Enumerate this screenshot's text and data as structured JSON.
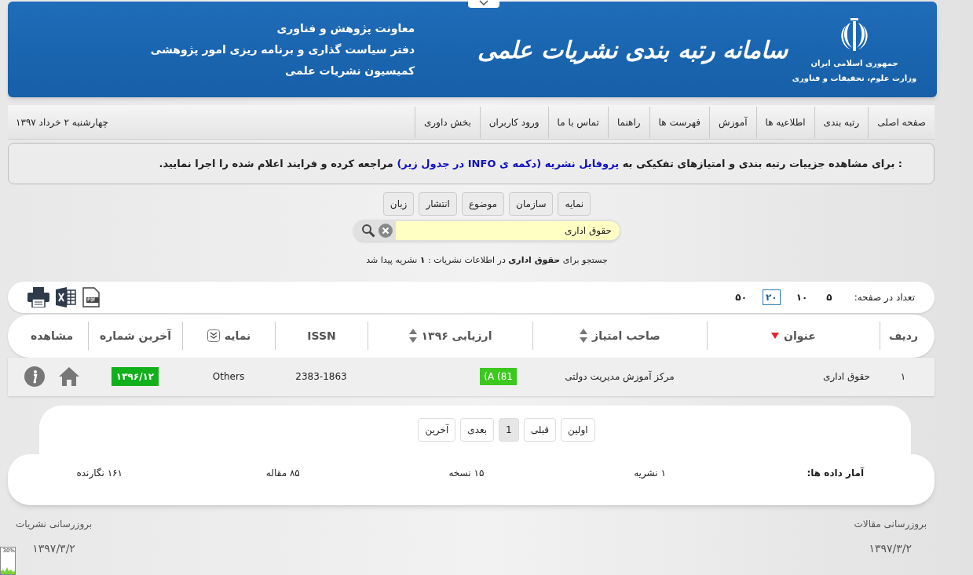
{
  "header": {
    "emblem_lines": [
      "جمهوری اسلامی ایران",
      "وزارت علوم، تحقیقات و فناوری"
    ],
    "site_title": "سامانه رتبه بندی نشریات علمی",
    "org_lines": [
      "معاونت پژوهش و فناوری",
      "دفتر سیاست گذاری و برنامه ریزی امور پژوهشی",
      "کمیسیون نشریات علمی"
    ]
  },
  "nav": {
    "items": [
      "صفحه اصلی",
      "رتبه بندی",
      "اطلاعیه ها",
      "آموزش",
      "فهرست ها",
      "راهنما",
      "تماس با ما",
      "ورود کاربران",
      "بخش داوری"
    ],
    "date": "چهارشنبه ۲ خرداد ۱۳۹۷"
  },
  "notice": {
    "before": ": برای مشاهده جزییات رتبه بندی و امتیازهای تفکیکی به ",
    "link": "پروفایل نشریه (دکمه ی INFO در جدول زیر)",
    "after": " مراجعه کرده و فرایند اعلام شده را اجرا نمایید."
  },
  "filters": [
    "نمایه",
    "سازمان",
    "موضوع",
    "انتشار",
    "زبان"
  ],
  "search": {
    "value": "حقوق اداری"
  },
  "result_text": "جستجو برای **حقوق اداری** در اطلاعات نشریات : **۱** نشریه پیدا شد",
  "page_size": {
    "label": "تعداد در صفحه:",
    "options": [
      {
        "label": "۵",
        "selected": false
      },
      {
        "label": "۱۰",
        "selected": false
      },
      {
        "label": "۲۰",
        "selected": true
      },
      {
        "label": "۵۰",
        "selected": false
      }
    ]
  },
  "table": {
    "columns": [
      {
        "label": "ردیف",
        "kind": "plain"
      },
      {
        "label": "عنوان",
        "kind": "sorted"
      },
      {
        "label": "صاحب امتیاز",
        "kind": "sortable"
      },
      {
        "label": "ارزیابی ۱۳۹۶",
        "kind": "sortable"
      },
      {
        "label": "ISSN",
        "kind": "plain"
      },
      {
        "label": "نمایه",
        "kind": "filter"
      },
      {
        "label": "آخرین شماره",
        "kind": "plain"
      },
      {
        "label": "مشاهده",
        "kind": "plain"
      }
    ],
    "rows": [
      {
        "index": "۱",
        "title": "حقوق اداری",
        "owner": "مرکز آموزش مدیریت دولتی",
        "rating": "(A (81",
        "issn": "2383-1863",
        "indexing": "Others",
        "last_issue": "۱۳۹۶/۱۲"
      }
    ]
  },
  "pagination": [
    {
      "label": "اولین",
      "selected": false
    },
    {
      "label": "قبلی",
      "selected": false
    },
    {
      "label": "1",
      "selected": true
    },
    {
      "label": "بعدی",
      "selected": false
    },
    {
      "label": "آخرین",
      "selected": false
    }
  ],
  "stats": {
    "label": "آمار داده ها:",
    "items": [
      "۱ نشریه",
      "۱۵ نسخه",
      "۸۵ مقاله",
      "۱۶۱ نگارنده"
    ]
  },
  "footer": {
    "articles_label": "بروزرسانی مقالات",
    "articles_date": "۱۳۹۷/۳/۲",
    "journals_label": "بروزرسانی نشریات",
    "journals_date": "۱۳۹۷/۳/۲"
  },
  "meter": {
    "label": "30%"
  }
}
